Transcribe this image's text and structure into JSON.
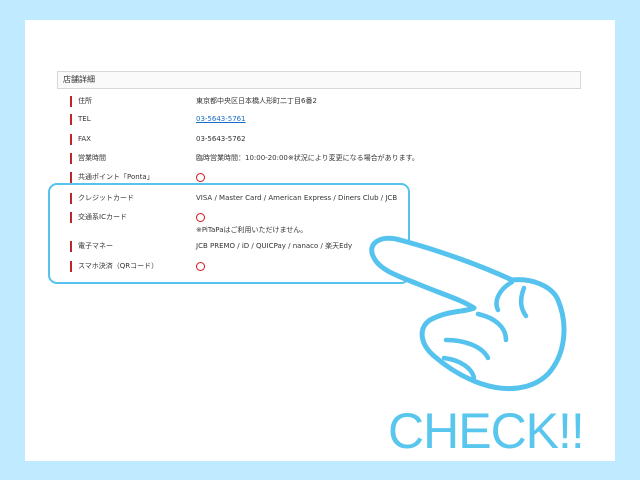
{
  "section": {
    "title": "店舗詳細"
  },
  "rows": [
    {
      "label": "住所",
      "value": "東京都中央区日本橋人形町二丁目6番2"
    },
    {
      "label": "TEL",
      "value": "03-5643-5761"
    },
    {
      "label": "FAX",
      "value": "03-5643-5762"
    },
    {
      "label": "営業時間",
      "value": "臨時営業時間：10:00-20:00※状況により変更になる場合があります。"
    },
    {
      "label": "共通ポイント「Ponta」",
      "value": "available"
    },
    {
      "label": "クレジットカード",
      "value": "VISA / Master Card / American Express / Diners Club / JCB"
    },
    {
      "label": "交通系ICカード",
      "value": "available",
      "note": "※PiTaPaはご利用いただけません。"
    },
    {
      "label": "電子マネー",
      "value": "JCB PREMO / iD / QUICPay / nanaco / 楽天Edy"
    },
    {
      "label": "スマホ決済（QRコード）",
      "value": "available"
    }
  ],
  "overlay": {
    "check_text": "CHECK!!"
  },
  "colors": {
    "accent_bar": "#c0252b",
    "circle": "#d41818",
    "highlight": "#55c3ee",
    "link": "#1a6dc7",
    "background": "#bfeaff"
  },
  "icons": {
    "hand": "pointing-hand-icon",
    "availability": "red-circle-icon"
  }
}
